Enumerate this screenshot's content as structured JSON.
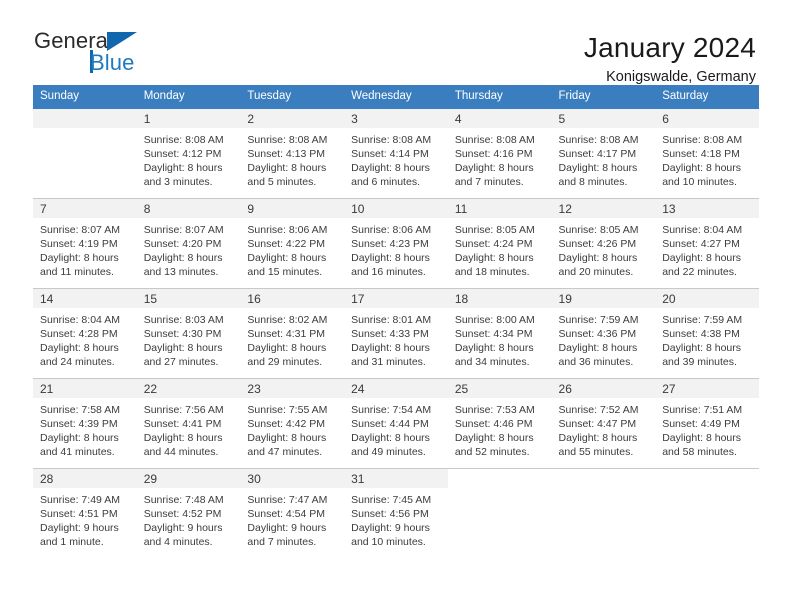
{
  "brand": {
    "name_part1": "General",
    "name_part2": "Blue",
    "logo_icon": "triangle-icon",
    "accent_color": "#1167ad"
  },
  "header": {
    "title": "January 2024",
    "subtitle": "Konigswalde, Germany"
  },
  "theme": {
    "header_row_bg": "#3a7ebf",
    "day_number_bg": "#f2f2f2",
    "grid_line": "#c8c8c8",
    "text": "#3c3c3c"
  },
  "weekdays": [
    "Sunday",
    "Monday",
    "Tuesday",
    "Wednesday",
    "Thursday",
    "Friday",
    "Saturday"
  ],
  "weeks": [
    [
      {
        "day": "",
        "sunrise": "",
        "sunset": "",
        "daylight1": "",
        "daylight2": "",
        "empty": true
      },
      {
        "day": "1",
        "sunrise": "Sunrise: 8:08 AM",
        "sunset": "Sunset: 4:12 PM",
        "daylight1": "Daylight: 8 hours",
        "daylight2": "and 3 minutes."
      },
      {
        "day": "2",
        "sunrise": "Sunrise: 8:08 AM",
        "sunset": "Sunset: 4:13 PM",
        "daylight1": "Daylight: 8 hours",
        "daylight2": "and 5 minutes."
      },
      {
        "day": "3",
        "sunrise": "Sunrise: 8:08 AM",
        "sunset": "Sunset: 4:14 PM",
        "daylight1": "Daylight: 8 hours",
        "daylight2": "and 6 minutes."
      },
      {
        "day": "4",
        "sunrise": "Sunrise: 8:08 AM",
        "sunset": "Sunset: 4:16 PM",
        "daylight1": "Daylight: 8 hours",
        "daylight2": "and 7 minutes."
      },
      {
        "day": "5",
        "sunrise": "Sunrise: 8:08 AM",
        "sunset": "Sunset: 4:17 PM",
        "daylight1": "Daylight: 8 hours",
        "daylight2": "and 8 minutes."
      },
      {
        "day": "6",
        "sunrise": "Sunrise: 8:08 AM",
        "sunset": "Sunset: 4:18 PM",
        "daylight1": "Daylight: 8 hours",
        "daylight2": "and 10 minutes."
      }
    ],
    [
      {
        "day": "7",
        "sunrise": "Sunrise: 8:07 AM",
        "sunset": "Sunset: 4:19 PM",
        "daylight1": "Daylight: 8 hours",
        "daylight2": "and 11 minutes."
      },
      {
        "day": "8",
        "sunrise": "Sunrise: 8:07 AM",
        "sunset": "Sunset: 4:20 PM",
        "daylight1": "Daylight: 8 hours",
        "daylight2": "and 13 minutes."
      },
      {
        "day": "9",
        "sunrise": "Sunrise: 8:06 AM",
        "sunset": "Sunset: 4:22 PM",
        "daylight1": "Daylight: 8 hours",
        "daylight2": "and 15 minutes."
      },
      {
        "day": "10",
        "sunrise": "Sunrise: 8:06 AM",
        "sunset": "Sunset: 4:23 PM",
        "daylight1": "Daylight: 8 hours",
        "daylight2": "and 16 minutes."
      },
      {
        "day": "11",
        "sunrise": "Sunrise: 8:05 AM",
        "sunset": "Sunset: 4:24 PM",
        "daylight1": "Daylight: 8 hours",
        "daylight2": "and 18 minutes."
      },
      {
        "day": "12",
        "sunrise": "Sunrise: 8:05 AM",
        "sunset": "Sunset: 4:26 PM",
        "daylight1": "Daylight: 8 hours",
        "daylight2": "and 20 minutes."
      },
      {
        "day": "13",
        "sunrise": "Sunrise: 8:04 AM",
        "sunset": "Sunset: 4:27 PM",
        "daylight1": "Daylight: 8 hours",
        "daylight2": "and 22 minutes."
      }
    ],
    [
      {
        "day": "14",
        "sunrise": "Sunrise: 8:04 AM",
        "sunset": "Sunset: 4:28 PM",
        "daylight1": "Daylight: 8 hours",
        "daylight2": "and 24 minutes."
      },
      {
        "day": "15",
        "sunrise": "Sunrise: 8:03 AM",
        "sunset": "Sunset: 4:30 PM",
        "daylight1": "Daylight: 8 hours",
        "daylight2": "and 27 minutes."
      },
      {
        "day": "16",
        "sunrise": "Sunrise: 8:02 AM",
        "sunset": "Sunset: 4:31 PM",
        "daylight1": "Daylight: 8 hours",
        "daylight2": "and 29 minutes."
      },
      {
        "day": "17",
        "sunrise": "Sunrise: 8:01 AM",
        "sunset": "Sunset: 4:33 PM",
        "daylight1": "Daylight: 8 hours",
        "daylight2": "and 31 minutes."
      },
      {
        "day": "18",
        "sunrise": "Sunrise: 8:00 AM",
        "sunset": "Sunset: 4:34 PM",
        "daylight1": "Daylight: 8 hours",
        "daylight2": "and 34 minutes."
      },
      {
        "day": "19",
        "sunrise": "Sunrise: 7:59 AM",
        "sunset": "Sunset: 4:36 PM",
        "daylight1": "Daylight: 8 hours",
        "daylight2": "and 36 minutes."
      },
      {
        "day": "20",
        "sunrise": "Sunrise: 7:59 AM",
        "sunset": "Sunset: 4:38 PM",
        "daylight1": "Daylight: 8 hours",
        "daylight2": "and 39 minutes."
      }
    ],
    [
      {
        "day": "21",
        "sunrise": "Sunrise: 7:58 AM",
        "sunset": "Sunset: 4:39 PM",
        "daylight1": "Daylight: 8 hours",
        "daylight2": "and 41 minutes."
      },
      {
        "day": "22",
        "sunrise": "Sunrise: 7:56 AM",
        "sunset": "Sunset: 4:41 PM",
        "daylight1": "Daylight: 8 hours",
        "daylight2": "and 44 minutes."
      },
      {
        "day": "23",
        "sunrise": "Sunrise: 7:55 AM",
        "sunset": "Sunset: 4:42 PM",
        "daylight1": "Daylight: 8 hours",
        "daylight2": "and 47 minutes."
      },
      {
        "day": "24",
        "sunrise": "Sunrise: 7:54 AM",
        "sunset": "Sunset: 4:44 PM",
        "daylight1": "Daylight: 8 hours",
        "daylight2": "and 49 minutes."
      },
      {
        "day": "25",
        "sunrise": "Sunrise: 7:53 AM",
        "sunset": "Sunset: 4:46 PM",
        "daylight1": "Daylight: 8 hours",
        "daylight2": "and 52 minutes."
      },
      {
        "day": "26",
        "sunrise": "Sunrise: 7:52 AM",
        "sunset": "Sunset: 4:47 PM",
        "daylight1": "Daylight: 8 hours",
        "daylight2": "and 55 minutes."
      },
      {
        "day": "27",
        "sunrise": "Sunrise: 7:51 AM",
        "sunset": "Sunset: 4:49 PM",
        "daylight1": "Daylight: 8 hours",
        "daylight2": "and 58 minutes."
      }
    ],
    [
      {
        "day": "28",
        "sunrise": "Sunrise: 7:49 AM",
        "sunset": "Sunset: 4:51 PM",
        "daylight1": "Daylight: 9 hours",
        "daylight2": "and 1 minute."
      },
      {
        "day": "29",
        "sunrise": "Sunrise: 7:48 AM",
        "sunset": "Sunset: 4:52 PM",
        "daylight1": "Daylight: 9 hours",
        "daylight2": "and 4 minutes."
      },
      {
        "day": "30",
        "sunrise": "Sunrise: 7:47 AM",
        "sunset": "Sunset: 4:54 PM",
        "daylight1": "Daylight: 9 hours",
        "daylight2": "and 7 minutes."
      },
      {
        "day": "31",
        "sunrise": "Sunrise: 7:45 AM",
        "sunset": "Sunset: 4:56 PM",
        "daylight1": "Daylight: 9 hours",
        "daylight2": "and 10 minutes."
      },
      {
        "day": "",
        "sunrise": "",
        "sunset": "",
        "daylight1": "",
        "daylight2": "",
        "blank": true
      },
      {
        "day": "",
        "sunrise": "",
        "sunset": "",
        "daylight1": "",
        "daylight2": "",
        "blank": true
      },
      {
        "day": "",
        "sunrise": "",
        "sunset": "",
        "daylight1": "",
        "daylight2": "",
        "blank": true
      }
    ]
  ]
}
